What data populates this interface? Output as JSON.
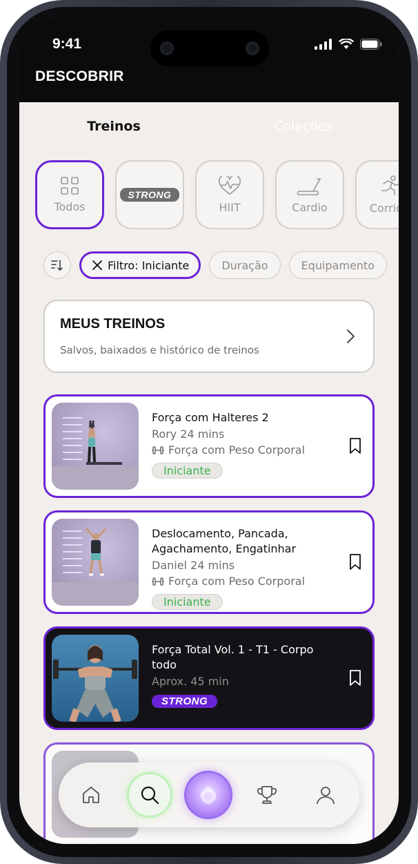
{
  "status_bar": {
    "time": "9:41"
  },
  "page_title": "DESCOBRIR",
  "tabs": [
    {
      "label": "Treinos",
      "active": true
    },
    {
      "label": "Coleções",
      "active": false
    }
  ],
  "categories": [
    {
      "label": "Todos",
      "icon": "grid-icon",
      "selected": true
    },
    {
      "label": "STRONG",
      "icon": "strong-logo",
      "selected": false
    },
    {
      "label": "HIIT",
      "icon": "heart-pulse-icon",
      "selected": false
    },
    {
      "label": "Cardio",
      "icon": "treadmill-icon",
      "selected": false
    },
    {
      "label": "Corrida",
      "icon": "running-icon",
      "selected": false
    }
  ],
  "filters": {
    "sort_icon": "sort-icon",
    "active_filter": "Filtro: Iniciante",
    "chips": [
      "Duração",
      "Equipamento"
    ]
  },
  "my_workouts": {
    "title": "MEUS TREINOS",
    "subtitle": "Salvos, baixados e histórico de treinos"
  },
  "workouts": [
    {
      "title": "Força com Halteres 2",
      "meta": "Rory  24 mins",
      "equipment": "Força com Peso Corporal",
      "level": "Iniciante"
    },
    {
      "title": "Deslocamento, Pancada, Agachamento, Engatinhar",
      "meta": "Daniel  24 mins",
      "equipment": "Força com Peso Corporal",
      "level": "Iniciante"
    },
    {
      "title": "Força Total Vol. 1 - T1 - Corpo todo",
      "meta": "Aprox. 45 min",
      "brand": "STRONG"
    }
  ],
  "bottom_nav": [
    "home-icon",
    "search-icon",
    "orb-icon",
    "trophy-icon",
    "profile-icon"
  ],
  "colors": {
    "accent": "#6a23d8",
    "level_green": "#3fb24c",
    "background": "#f1eeeb"
  }
}
